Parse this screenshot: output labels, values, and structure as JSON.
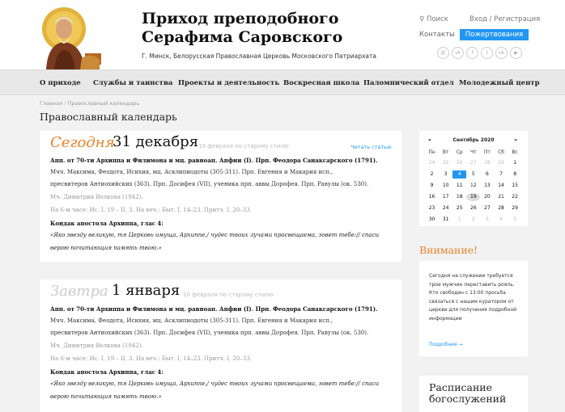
{
  "header": {
    "title_line1": "Приход преподобного",
    "title_line2": "Серафима Саровского",
    "subtitle": "Г. Минск, Белорусская Православная Церковь Московского Патриархата",
    "search": "Поиск",
    "login": "Вход / Регистрация",
    "contacts": "Контакты",
    "donate": "Пожертвования",
    "socials": [
      "mail",
      "vk",
      "fb",
      "tw",
      "ok",
      "yt"
    ]
  },
  "nav": [
    "О приходе",
    "Службы и таинства",
    "Проекты и деятельность",
    "Воскресная школа",
    "Паломнический отдел",
    "Молодежный центр"
  ],
  "breadcrumb": {
    "home": "Главная",
    "sep": "/",
    "current": "Православный календарь"
  },
  "page_title": "Православный календарь",
  "days": [
    {
      "label": "Сегодня",
      "date": "31 декабря",
      "old_style": "19 февраля по старому стилю",
      "read_link": "Читать статью",
      "l1": "Апп. от 70-ти Архиппа и Филимона и мц. равноап. Апфии (I). Прп. Феодора Санаксарского (1791).",
      "l2": "Мчч. Максима, Феодота, Исихия, мц. Асклипиодоты (305-311). Прп. Евгения и Макария исп.,",
      "l3": "пресвитеров Антиохийских (363). Прп. Досифея (VII), ученика прп. аввы Дорофея. Прп. Равулы (ок. 530).",
      "l4": "Мч. Димитрия Волкова (1942).",
      "l5": "На 6-м часе: Ис. I, 19 – II, 3. На веч.: Быт. I, 14–23. Притч. I, 20–33.",
      "l6": "Кондак апостола Архиппа, глас 4:",
      "l7": "«Яко звезду великую, тя Церковь имуща, Архиппе,/ чудес твоих лучами просвещаема, зовет тебе:// спаси",
      "l8": "верою почитающия память твою.»"
    },
    {
      "label": "Завтра",
      "date": "1 января",
      "old_style": "20 февраля по старому стилю",
      "l1": "Апп. от 70-ти Архиппа и Филимона и мц. равноап. Апфии (I). Прп. Феодора Санаксарского (1791).",
      "l2": "Мчч. Максима, Феодота, Исихия, мц. Асклипиодоты (305-311). Прп. Евгения и Макария исп.,",
      "l3": "пресвитеров Антиохийских (363). Прп. Досифея (VII), ученика прп. аввы Дорофея. Прп. Равулы (ок. 530).",
      "l4": "Мч. Димитрия Волкова (1942).",
      "l5": "На 6-м часе: Ис. I, 19 – II, 3. На веч.: Быт. I, 14–23. Притч. I, 20–33.",
      "l6": "Кондак апостола Архиппа, глас 4:",
      "l7": "«Яко звезду великую, тя Церковь имуща, Архиппе,/ чудес твоих лучами просвещаема, зовет тебе:// спаси",
      "l8": "верою почитающия память твою.»"
    }
  ],
  "calendar": {
    "prev": "«",
    "next": "»",
    "month": "Сентябрь 2020",
    "weekdays": [
      "Пн",
      "Вт",
      "Ср",
      "Чт",
      "Пт",
      "Сб",
      "Вс"
    ],
    "weeks": [
      [
        "24",
        "25",
        "26",
        "27",
        "28",
        "29",
        "1"
      ],
      [
        "2",
        "3",
        "4",
        "5",
        "6",
        "7",
        "8"
      ],
      [
        "9",
        "10",
        "11",
        "12",
        "13",
        "14",
        "15"
      ],
      [
        "16",
        "17",
        "18",
        "19",
        "20",
        "21",
        "22"
      ],
      [
        "23",
        "24",
        "25",
        "26",
        "27",
        "28",
        "29"
      ],
      [
        "30",
        "31",
        "1",
        "2",
        "3",
        "4",
        "5"
      ]
    ],
    "selected_day": "4",
    "hovered_day": "19"
  },
  "attention": {
    "title": "Внимание!",
    "text": "Сегодня на служении требуется трое мужчин переставить рояль. Кто свободен с 13:00 просьба связаться с нашим куратором от церкви для получения подробной информации",
    "more": "Подробнее →"
  },
  "schedule": {
    "title": "Расписание богослужений"
  },
  "colors": {
    "accent": "#e8842b",
    "link": "#2196f3"
  }
}
